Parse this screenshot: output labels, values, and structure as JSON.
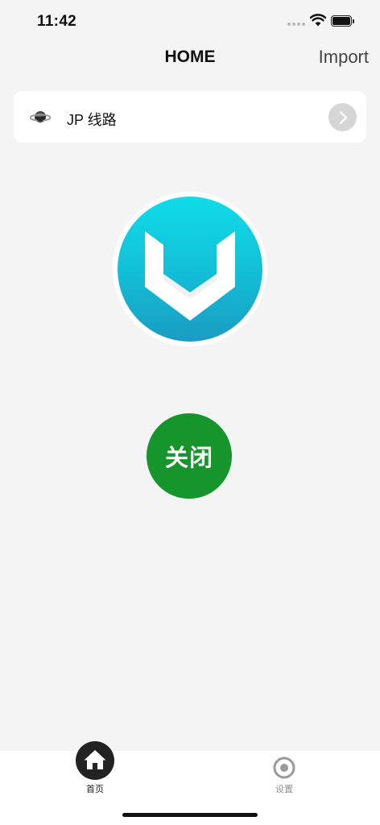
{
  "status_bar": {
    "time": "11:42",
    "icons": [
      "signal-dots-icon",
      "wifi-icon",
      "battery-icon"
    ]
  },
  "nav": {
    "title": "HOME",
    "import_label": "Import"
  },
  "route": {
    "icon": "planet-icon",
    "label": "JP 线路",
    "action_icon": "chevron-right-icon"
  },
  "logo": {
    "icon": "v-shield-logo",
    "colors": {
      "top": "#10dce9",
      "bottom": "#1a9cc3"
    }
  },
  "connection": {
    "button_label": "关闭",
    "color": "#17952d"
  },
  "tabs": [
    {
      "label": "首页",
      "icon": "home-icon",
      "active": true
    },
    {
      "label": "设置",
      "icon": "target-icon",
      "active": false
    }
  ],
  "colors": {
    "background": "#f4f4f4",
    "card": "#ffffff",
    "tab_active": "#222222",
    "tab_inactive": "#8f8f8f"
  }
}
